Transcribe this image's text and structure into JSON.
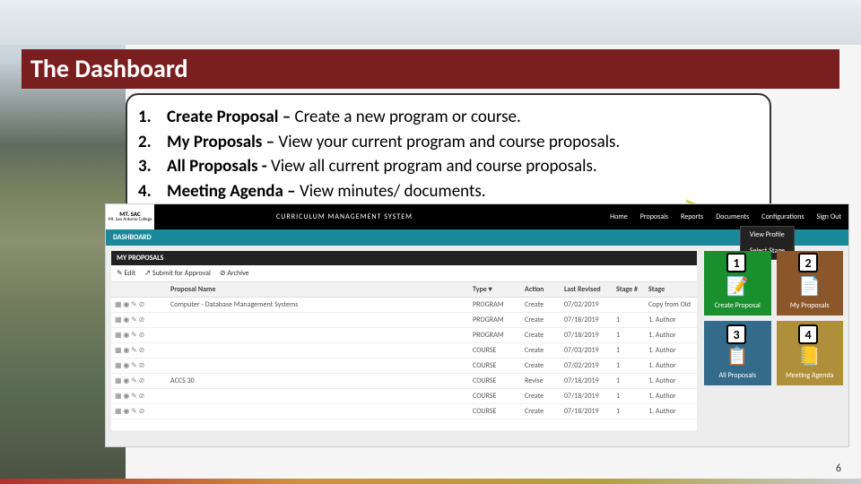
{
  "title": "The Dashboard",
  "explain": [
    {
      "num": "1.",
      "bold": "Create Proposal – ",
      "rest": "Create a new program or course."
    },
    {
      "num": "2.",
      "bold": "My Proposals – ",
      "rest": "View your current program and course proposals."
    },
    {
      "num": "3.",
      "bold": "All Proposals - ",
      "rest": "View all current program and course proposals."
    },
    {
      "num": "4.",
      "bold": "Meeting Agenda – ",
      "rest": "View minutes/ documents."
    }
  ],
  "nav": {
    "logo_main": "MT. SAC",
    "logo_sub": "Mt. San Antonio College",
    "system_title": "CURRICULUM MANAGEMENT SYSTEM",
    "links": [
      "Home",
      "Proposals",
      "Reports",
      "Documents",
      "Configurations",
      "Sign Out"
    ],
    "config_menu": [
      "View Profile",
      "Select Stage"
    ]
  },
  "teal_label": "DASHBOARD",
  "panel_title": "MY PROPOSALS",
  "actions": {
    "edit": "✎ Edit",
    "submit": "↗ Submit for Approval",
    "archive": "⊘ Archive"
  },
  "table": {
    "headers": [
      "",
      "Proposal Name",
      "Type ▾",
      "Action",
      "Last Revised",
      "Stage #",
      "Stage"
    ],
    "rows": [
      {
        "name": "Computer - Database Management Systems",
        "type": "PROGRAM",
        "action": "Create",
        "date": "07/02/2019",
        "snum": "",
        "stage": "Copy from Old"
      },
      {
        "name": "",
        "type": "PROGRAM",
        "action": "Create",
        "date": "07/18/2019",
        "snum": "1",
        "stage": "1. Author"
      },
      {
        "name": "",
        "type": "PROGRAM",
        "action": "Create",
        "date": "07/18/2019",
        "snum": "1",
        "stage": "1. Author"
      },
      {
        "name": "",
        "type": "COURSE",
        "action": "Create",
        "date": "07/03/2019",
        "snum": "1",
        "stage": "1. Author"
      },
      {
        "name": "",
        "type": "COURSE",
        "action": "Create",
        "date": "07/02/2019",
        "snum": "1",
        "stage": "1. Author"
      },
      {
        "name": "ACCS 30",
        "type": "COURSE",
        "action": "Revise",
        "date": "07/18/2019",
        "snum": "1",
        "stage": "1. Author"
      },
      {
        "name": "",
        "type": "COURSE",
        "action": "Create",
        "date": "07/18/2019",
        "snum": "1",
        "stage": "1. Author"
      },
      {
        "name": "",
        "type": "COURSE",
        "action": "Create",
        "date": "07/18/2019",
        "snum": "1",
        "stage": "1. Author"
      }
    ]
  },
  "tiles": [
    {
      "label": "Create Proposal",
      "icon": "📝"
    },
    {
      "label": "My Proposals",
      "icon": "📄"
    },
    {
      "label": "All Proposals",
      "icon": "📋"
    },
    {
      "label": "Meeting Agenda",
      "icon": "📒"
    }
  ],
  "annot": {
    "a1": "1",
    "a2": "2",
    "a3": "3",
    "a4": "4"
  },
  "page_number": "6"
}
